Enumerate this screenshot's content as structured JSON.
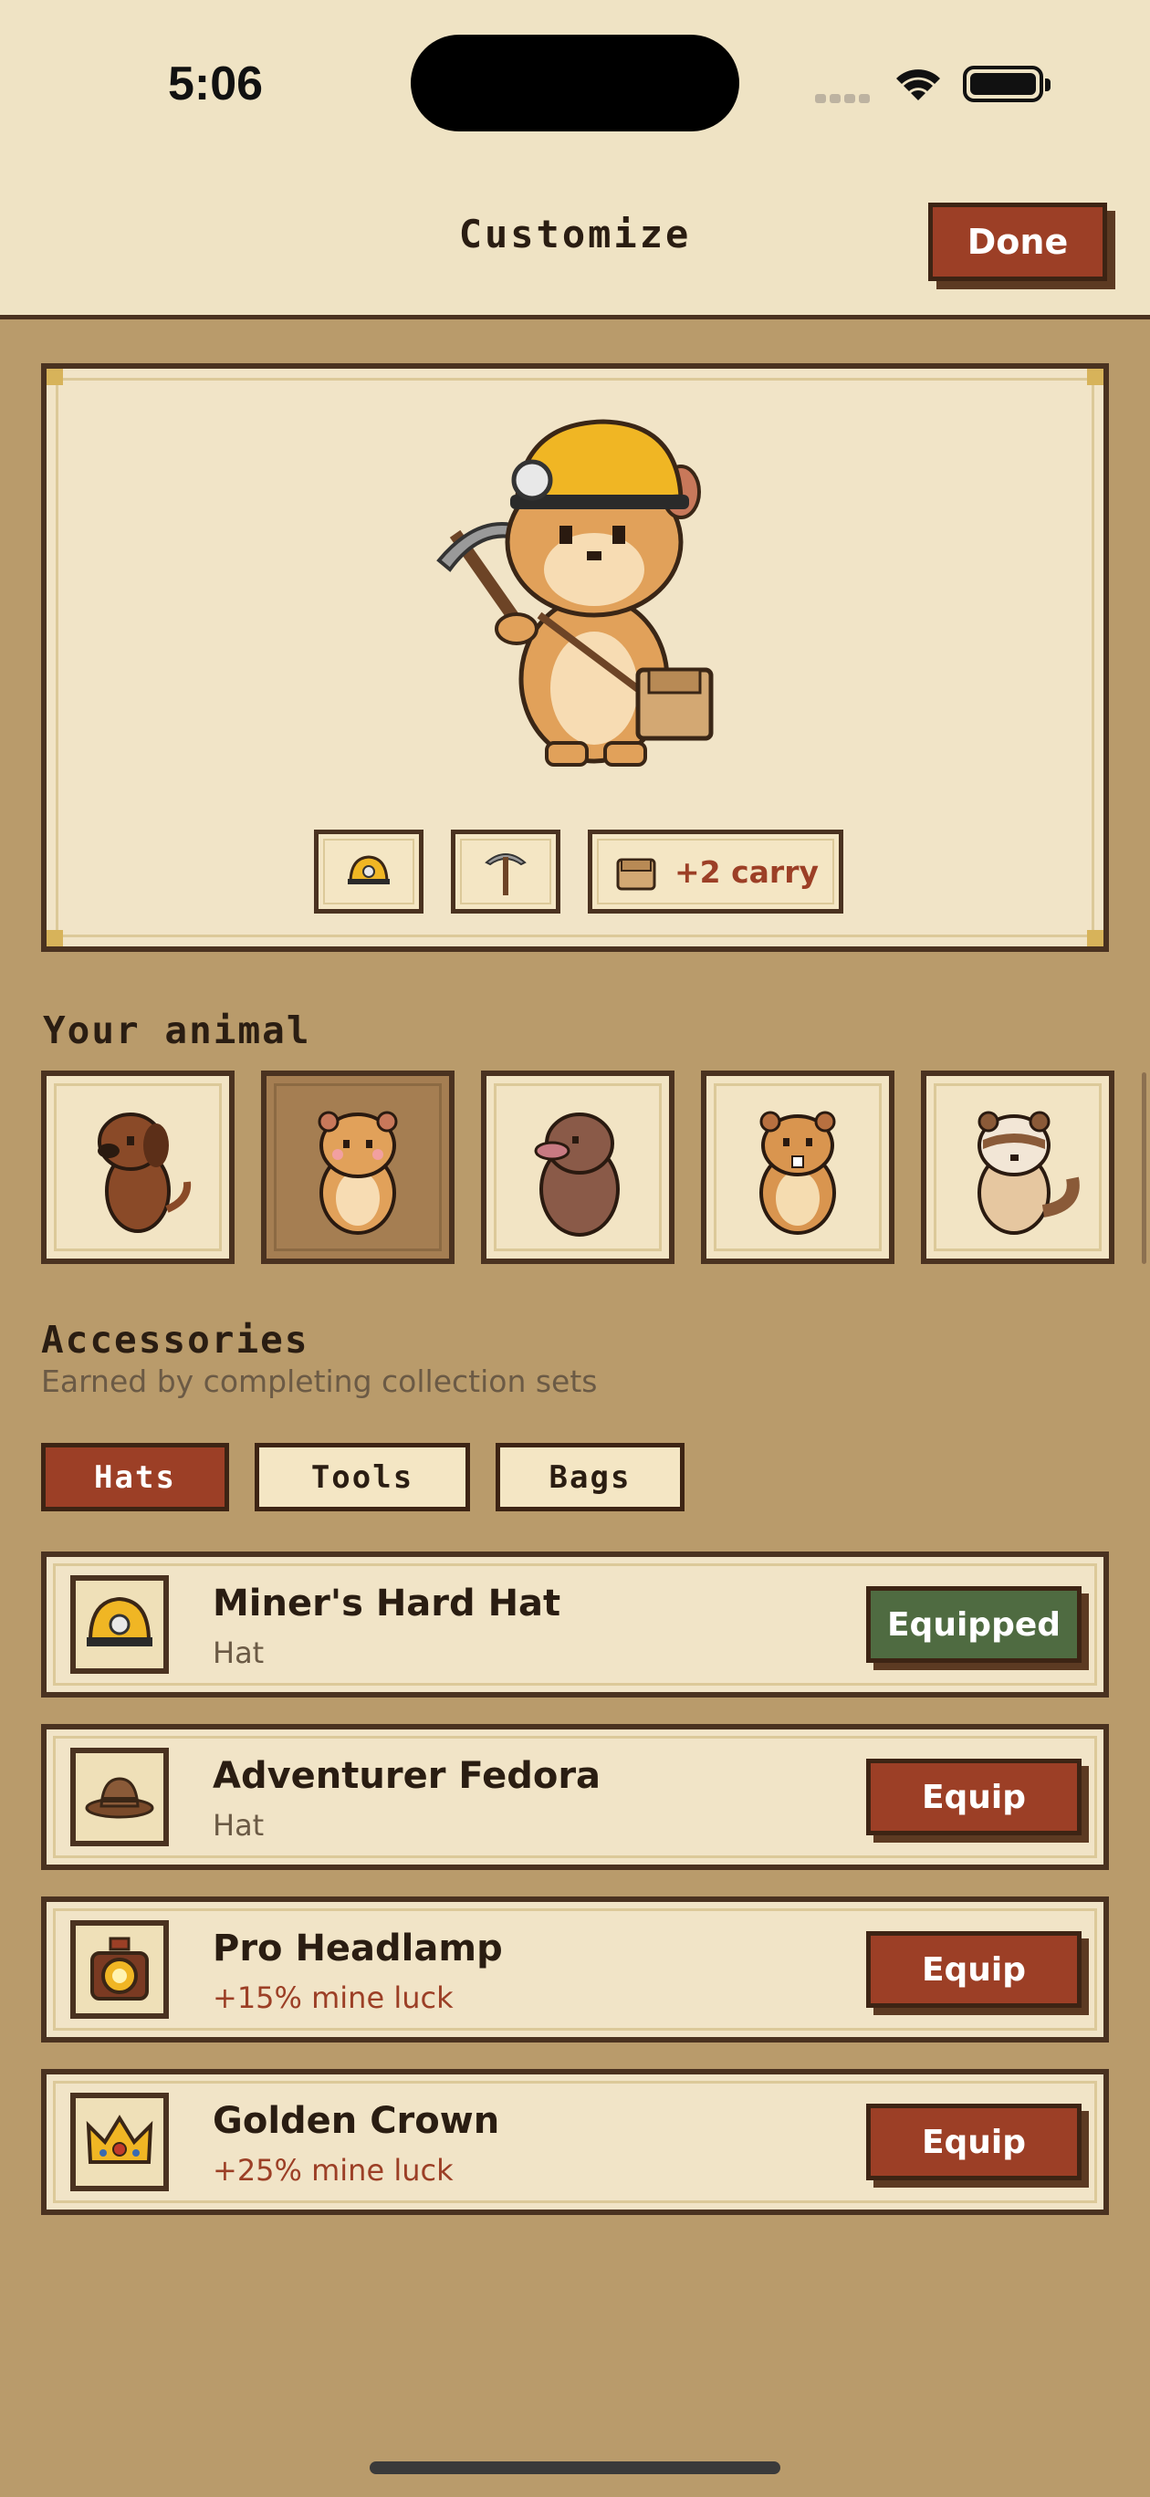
{
  "status_bar": {
    "time": "5:06"
  },
  "header": {
    "title": "Customize",
    "done_label": "Done"
  },
  "preview": {
    "chips": [
      {
        "icon": "hard-hat-icon",
        "label": ""
      },
      {
        "icon": "pickaxe-icon",
        "label": ""
      },
      {
        "icon": "bag-icon",
        "label": "+2 carry"
      }
    ]
  },
  "animals": {
    "title": "Your animal",
    "items": [
      {
        "name": "dachshund",
        "selected": false
      },
      {
        "name": "hamster",
        "selected": true
      },
      {
        "name": "mole",
        "selected": false
      },
      {
        "name": "beaver",
        "selected": false
      },
      {
        "name": "raccoon",
        "selected": false
      }
    ]
  },
  "accessories": {
    "title": "Accessories",
    "subtitle": "Earned by completing collection sets",
    "tabs": [
      "Hats",
      "Tools",
      "Bags"
    ],
    "active_tab": "Hats",
    "items": [
      {
        "name": "Miner's Hard Hat",
        "sub": "Hat",
        "button": "Equipped",
        "icon": "hard-hat-icon"
      },
      {
        "name": "Adventurer Fedora",
        "sub": "Hat",
        "button": "Equip",
        "icon": "fedora-icon"
      },
      {
        "name": "Pro Headlamp",
        "sub": "+15% mine luck",
        "button": "Equip",
        "icon": "headlamp-icon"
      },
      {
        "name": "Golden Crown",
        "sub": "+25% mine luck",
        "button": "Equip",
        "icon": "crown-icon"
      }
    ]
  },
  "colors": {
    "header_bg": "#efe3c4",
    "page_bg": "#b99b6b",
    "accent_red": "#9c3f26",
    "equipped_green": "#4f6b41",
    "border_brown": "#4a3220"
  }
}
